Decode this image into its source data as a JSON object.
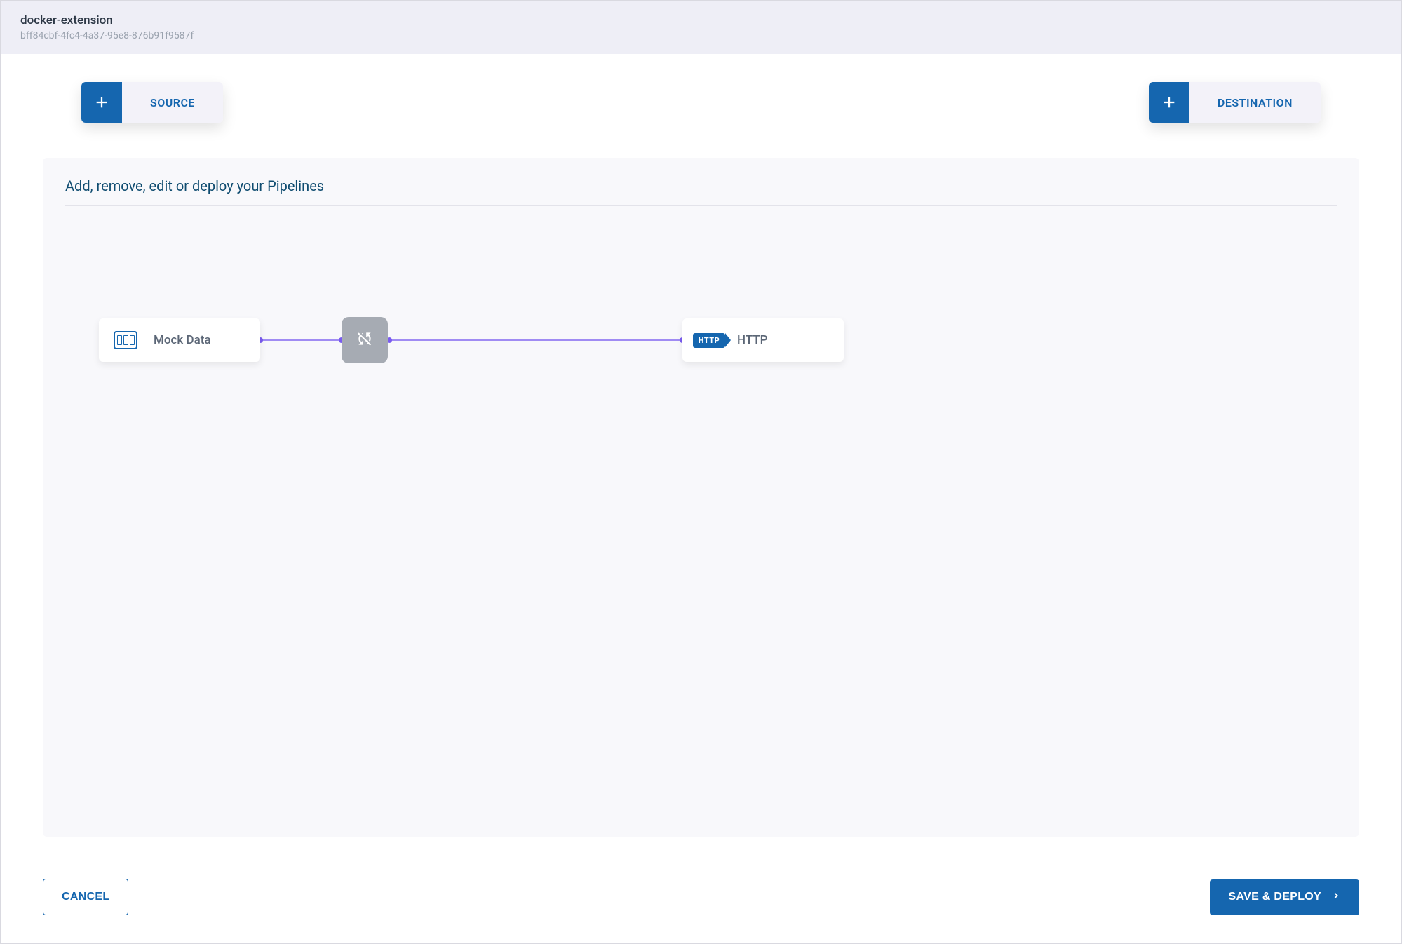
{
  "header": {
    "title": "docker-extension",
    "subtitle": "bff84cbf-4fc4-4a37-95e8-876b91f9587f"
  },
  "topButtons": {
    "source": "SOURCE",
    "destination": "DESTINATION"
  },
  "panel": {
    "title": "Add, remove, edit or deploy your Pipelines"
  },
  "nodes": {
    "source": {
      "label": "Mock Data"
    },
    "destination": {
      "label": "HTTP",
      "badge": "HTTP"
    }
  },
  "footer": {
    "cancel": "CANCEL",
    "save": "SAVE & DEPLOY"
  }
}
